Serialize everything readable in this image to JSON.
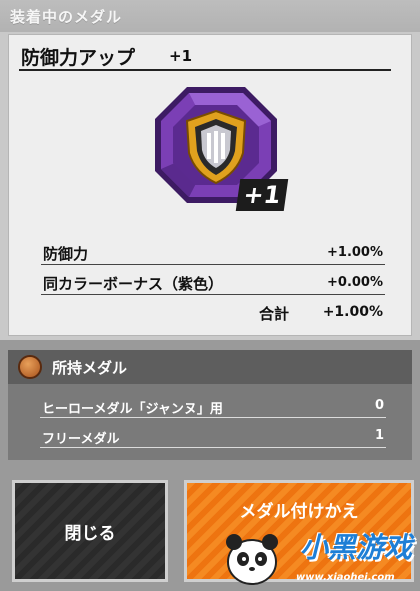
{
  "header": {
    "title": "装着中のメダル"
  },
  "medal": {
    "name": "防御力アップ",
    "level": "+1",
    "badge": "+1",
    "icon": "shield-medal-icon",
    "colors": {
      "octagon": "#7b3fb5",
      "ring": "#e0a11e",
      "shield": "#b8b8c0"
    }
  },
  "stats": [
    {
      "label": "防御力",
      "value": "+1.00%"
    },
    {
      "label": "同カラーボーナス（紫色）",
      "value": "+0.00%"
    }
  ],
  "total": {
    "label": "合計",
    "value": "+1.00%"
  },
  "owned": {
    "title": "所持メダル",
    "icon": "medal-emblem-icon",
    "rows": [
      {
        "label": "ヒーローメダル「ジャンヌ」用",
        "value": "0"
      },
      {
        "label": "フリーメダル",
        "value": "1"
      }
    ]
  },
  "buttons": {
    "close": "閉じる",
    "swap": "メダル付けかえ"
  },
  "watermark": {
    "brand": "小黑游戏",
    "url": "www.xiaohei.com"
  }
}
